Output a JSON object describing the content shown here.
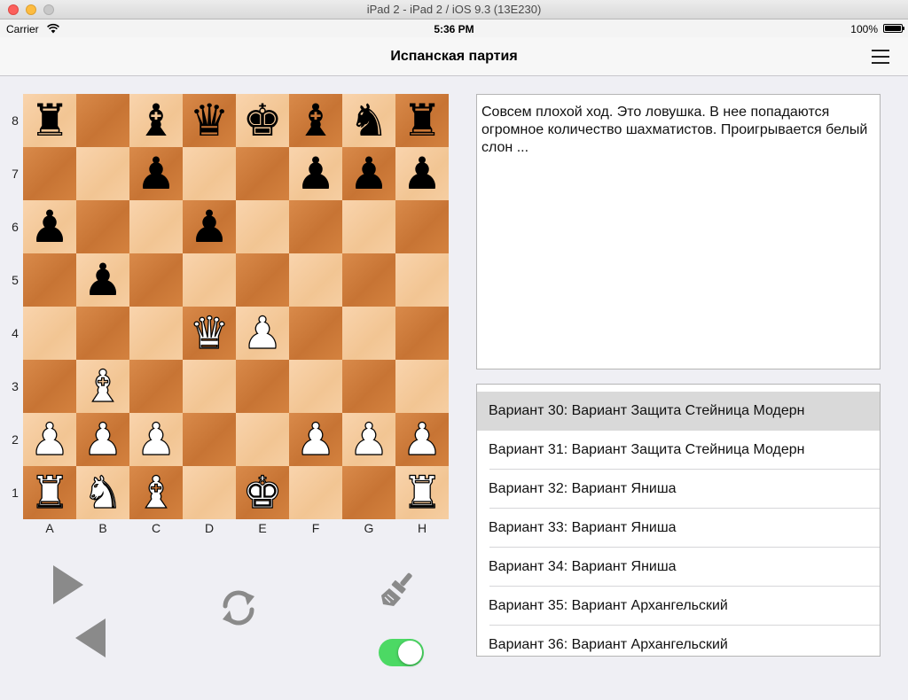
{
  "window": {
    "title": "iPad 2 - iPad 2 / iOS 9.3 (13E230)"
  },
  "status_bar": {
    "carrier": "Carrier",
    "time": "5:36 PM",
    "battery": "100%",
    "battery_level": 1.0
  },
  "nav": {
    "title": "Испанская партия",
    "menu_icon": "hamburger-menu-icon"
  },
  "board": {
    "ranks": [
      "8",
      "7",
      "6",
      "5",
      "4",
      "3",
      "2",
      "1"
    ],
    "files": [
      "A",
      "B",
      "C",
      "D",
      "E",
      "F",
      "G",
      "H"
    ],
    "position": [
      [
        "bR",
        "",
        "bB",
        "bQ",
        "bK",
        "bB",
        "bN",
        "bR"
      ],
      [
        "",
        "",
        "bP",
        "",
        "",
        "bP",
        "bP",
        "bP"
      ],
      [
        "bP",
        "",
        "",
        "bP",
        "",
        "",
        "",
        ""
      ],
      [
        "",
        "bP",
        "",
        "",
        "",
        "",
        "",
        ""
      ],
      [
        "",
        "",
        "",
        "wQ",
        "wP",
        "",
        "",
        ""
      ],
      [
        "",
        "wB",
        "",
        "",
        "",
        "",
        "",
        ""
      ],
      [
        "wP",
        "wP",
        "wP",
        "",
        "",
        "wP",
        "wP",
        "wP"
      ],
      [
        "wR",
        "wN",
        "wB",
        "",
        "wK",
        "",
        "",
        "wR"
      ]
    ]
  },
  "controls": {
    "next_icon": "play-forward-icon",
    "prev_icon": "play-back-icon",
    "flip_icon": "rotate-board-icon",
    "brush_icon": "brush-icon",
    "toggle_on": true,
    "colors": {
      "icon_gray": "#8a8a8a",
      "toggle_green": "#4cd964"
    }
  },
  "comment": "Совсем плохой ход. Это ловушка. В нее попадаются огромное количество шахматистов. Проигрывается белый слон ...",
  "variants": [
    "Вариант 30: Вариант Защита Стейница Модерн",
    "Вариант 31: Вариант Защита Стейница Модерн",
    "Вариант 32: Вариант Яниша",
    "Вариант 33: Вариант Яниша",
    "Вариант 34: Вариант Яниша",
    "Вариант 35: Вариант Архангельский",
    "Вариант 36: Вариант Архангельский"
  ],
  "selected_variant_index": 0
}
